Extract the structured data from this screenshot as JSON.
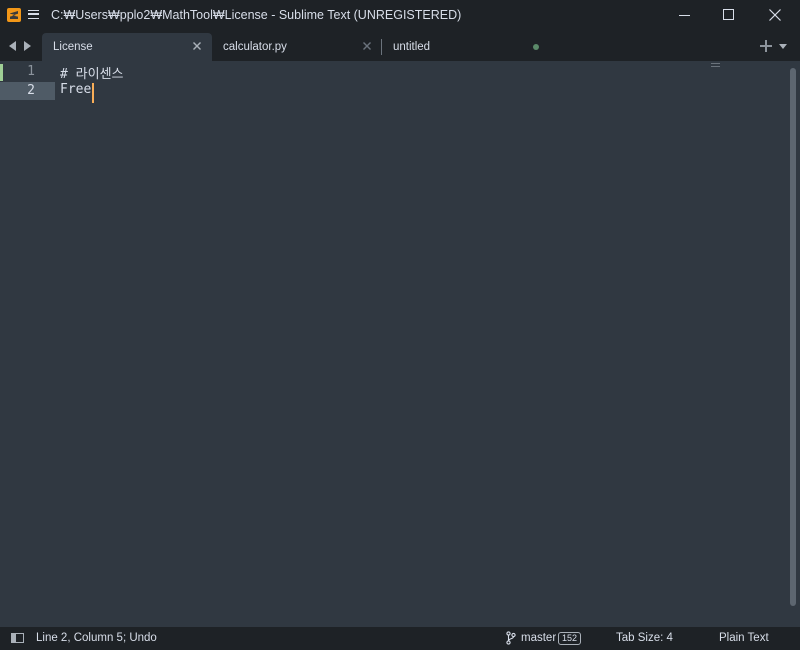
{
  "window": {
    "title": "C:₩Users₩pplo2₩MathTool₩License - Sublime Text (UNREGISTERED)"
  },
  "icons": {
    "app": "sublime-text-icon",
    "menu": "hamburger-menu-icon",
    "minimize": "minimize-icon",
    "maximize": "maximize-icon",
    "close": "close-icon",
    "nav_back": "arrow-left-icon",
    "nav_forward": "arrow-right-icon",
    "new_tab": "plus-icon",
    "tab_list": "chevron-down-icon",
    "branch": "git-branch-icon",
    "panel": "sidebar-toggle-icon"
  },
  "tabs": [
    {
      "label": "License",
      "active": true,
      "close": "×"
    },
    {
      "label": "calculator.py",
      "active": false,
      "close": "×"
    },
    {
      "label": "untitled",
      "active": false,
      "dirty": true
    }
  ],
  "editor": {
    "lines": [
      {
        "number": "1",
        "text": "# 라이센스",
        "modified": true
      },
      {
        "number": "2",
        "text": "Free",
        "current": true
      }
    ]
  },
  "status": {
    "position": "Line 2, Column 5; Undo",
    "branch": "master",
    "branch_count": "152",
    "tab_size": "Tab Size: 4",
    "syntax": "Plain Text"
  },
  "colors": {
    "background": "#303841",
    "chrome": "#1e2226",
    "text": "#d8dee9",
    "caret": "#f9ae58",
    "modified_marker": "#9fcf96",
    "dirty_dot": "#5b8a69"
  }
}
